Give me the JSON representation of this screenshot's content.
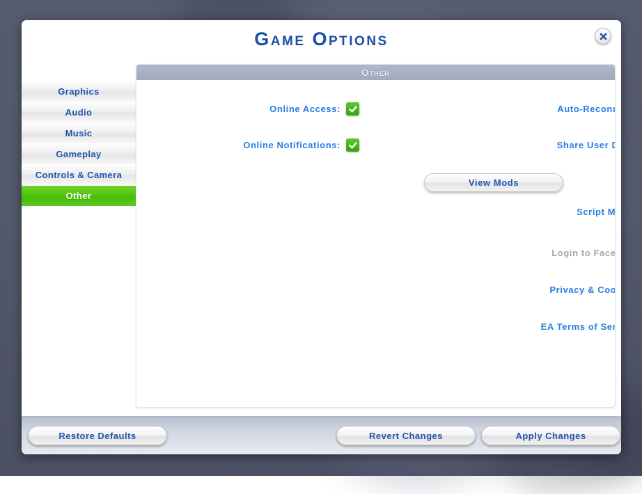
{
  "background": {
    "offline_title": "You are Offline.",
    "offline_subtitle": "Click here to connect online & view",
    "color": "#555a6e"
  },
  "dialog": {
    "title": "Game Options",
    "close_icon": "close-icon"
  },
  "sidebar": {
    "items": [
      {
        "label": "Graphics",
        "selected": false
      },
      {
        "label": "Audio",
        "selected": false
      },
      {
        "label": "Music",
        "selected": false
      },
      {
        "label": "Gameplay",
        "selected": false
      },
      {
        "label": "Controls & Camera",
        "selected": false
      },
      {
        "label": "Other",
        "selected": true
      }
    ],
    "selected_color": "#4fc410"
  },
  "content": {
    "section_header": "Other",
    "accent_color": "#2a7de1",
    "options": [
      {
        "label": "Online Access:",
        "checked": true
      },
      {
        "label": "Auto-Reconnect:",
        "checked": true
      },
      {
        "label": "Online Notifications:",
        "checked": true
      },
      {
        "label": "Share User Data:",
        "checked": true
      },
      {
        "label": "Script Mods:",
        "checked": true
      }
    ],
    "view_mods_button": "View Mods",
    "links": [
      {
        "label": "Login to Facebook",
        "icon": "facebook-icon",
        "disabled": true
      },
      {
        "label": "Privacy & Cookies",
        "icon": "shield-check-icon",
        "disabled": false
      },
      {
        "label": "EA Terms of Service",
        "icon": "document-icon",
        "disabled": false
      }
    ]
  },
  "footer": {
    "restore_label": "Restore Defaults",
    "revert_label": "Revert Changes",
    "apply_label": "Apply Changes"
  }
}
